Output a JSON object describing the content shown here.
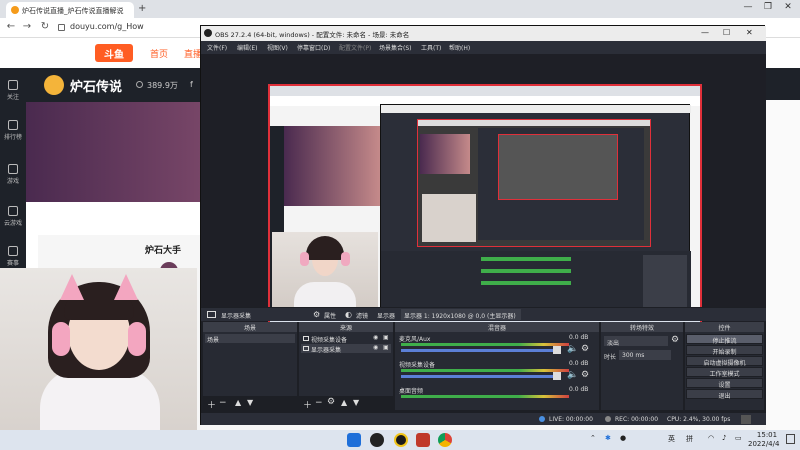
{
  "browser": {
    "tab_title": "炉石传说直播_炉石传说直播解说",
    "url": "douyu.com/g_How",
    "window_controls": {
      "minimize": "—",
      "restore": "❐",
      "close": "✕"
    },
    "nav": {
      "back": "←",
      "forward": "→",
      "reload": "↻",
      "new_tab": "+"
    }
  },
  "douyu": {
    "logo_text": "斗鱼",
    "nav": [
      "首页",
      "直播"
    ],
    "game_title": "炉石传说",
    "followers": "389.9万",
    "followers_unit": "f",
    "sidebar": [
      "关注",
      "排行榜",
      "游戏",
      "云游戏",
      "赛事"
    ],
    "anchor_name": "炉石大手"
  },
  "obs": {
    "title": "OBS 27.2.4 (64-bit, windows) - 配置文件: 未命名 - 场景: 未命名",
    "menu": [
      "文件(F)",
      "编辑(E)",
      "视图(V)",
      "停靠窗口(D)",
      "配置文件(P)",
      "场景集合(S)",
      "工具(T)",
      "帮助(H)"
    ],
    "source_toolbar": {
      "source_name": "显示器采集",
      "properties": "属性",
      "filters": "滤镜",
      "display_label": "显示器",
      "display_value": "显示器 1: 1920x1080 @ 0,0 (主显示器)"
    },
    "docks": {
      "scenes": {
        "title": "场景",
        "items": [
          "场景"
        ]
      },
      "sources": {
        "title": "来源",
        "items": [
          "视频采集设备",
          "显示器采集"
        ]
      },
      "mixer": {
        "title": "混音器",
        "channels": [
          {
            "name": "麦克风/Aux",
            "db": "0.0 dB"
          },
          {
            "name": "视频采集设备",
            "db": "0.0 dB"
          },
          {
            "name": "桌面音频",
            "db": "0.0 dB"
          }
        ]
      },
      "transitions": {
        "title": "转场特效",
        "type": "淡出",
        "duration_label": "时长",
        "duration": "300 ms"
      },
      "controls": {
        "title": "控件",
        "buttons": [
          "停止推流",
          "开始录制",
          "启动虚拟摄像机",
          "工作室模式",
          "设置",
          "退出"
        ]
      }
    },
    "status": {
      "live": "LIVE: 00:00:00",
      "rec": "REC: 00:00:00",
      "cpu": "CPU: 2.4%, 30.00 fps"
    }
  },
  "taskbar": {
    "lang": "英",
    "ime": "拼",
    "time": "15:01",
    "date": "2022/4/4"
  },
  "colors": {
    "preview_border": "#e0303a",
    "obs_bg": "#2b2e38",
    "douyu_orange": "#ff5d23"
  }
}
